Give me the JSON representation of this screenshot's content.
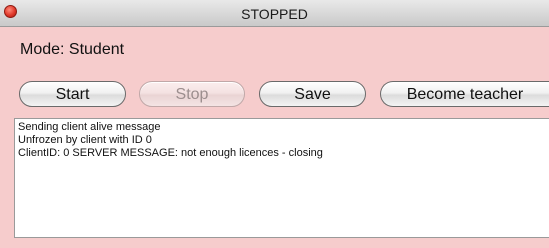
{
  "window": {
    "title": "STOPPED"
  },
  "mode_label": "Mode: Student",
  "buttons": {
    "start": "Start",
    "stop": "Stop",
    "save": "Save",
    "become_teacher": "Become teacher"
  },
  "buttons_state": {
    "stop_enabled": false
  },
  "log": {
    "lines": [
      "Sending client alive message",
      "Unfrozen by client with ID 0",
      "ClientID: 0 SERVER MESSAGE: not enough licences - closing"
    ]
  },
  "colors": {
    "window_background": "#f6cccc",
    "close_button": "#e0392b"
  }
}
